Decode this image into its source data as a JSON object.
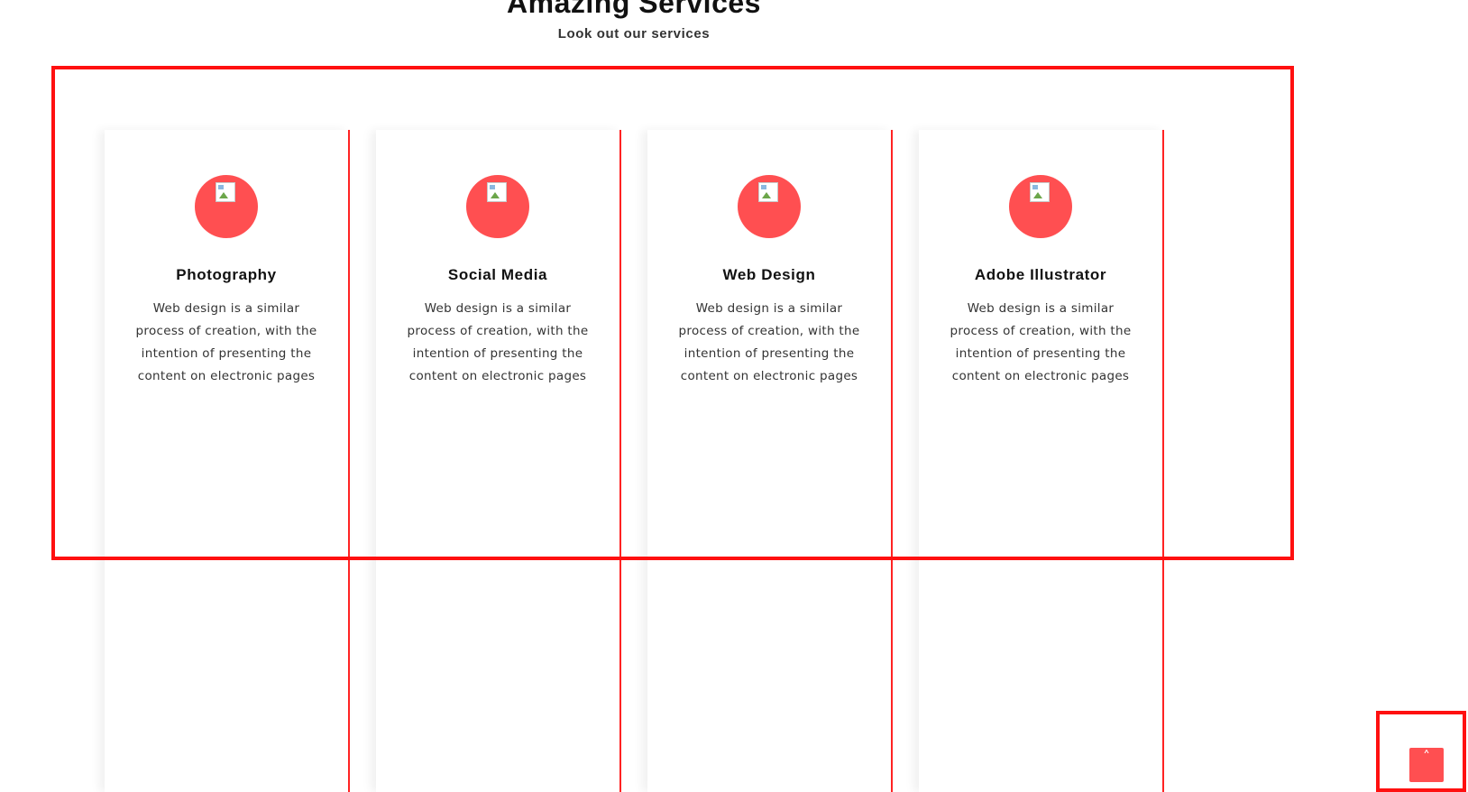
{
  "header": {
    "title": "Amazing Services",
    "subtitle": "Look out our services"
  },
  "services": [
    {
      "title": "Photography",
      "description": "Web design is a similar process of creation, with the intention of presenting the content on electronic pages",
      "icon": "broken-image-icon"
    },
    {
      "title": "Social Media",
      "description": "Web design is a similar process of creation, with the intention of presenting the content on electronic pages",
      "icon": "broken-image-icon"
    },
    {
      "title": "Web Design",
      "description": "Web design is a similar process of creation, with the intention of presenting the content on electronic pages",
      "icon": "broken-image-icon"
    },
    {
      "title": "Adobe Illustrator",
      "description": "Web design is a similar process of creation, with the intention of presenting the content on electronic pages",
      "icon": "broken-image-icon"
    }
  ],
  "scroll_top": {
    "icon": "caret-up-icon",
    "glyph": "˄"
  },
  "colors": {
    "accent": "#ff4f51",
    "annotation": "#ff1010",
    "card_border": "#ff2323"
  }
}
